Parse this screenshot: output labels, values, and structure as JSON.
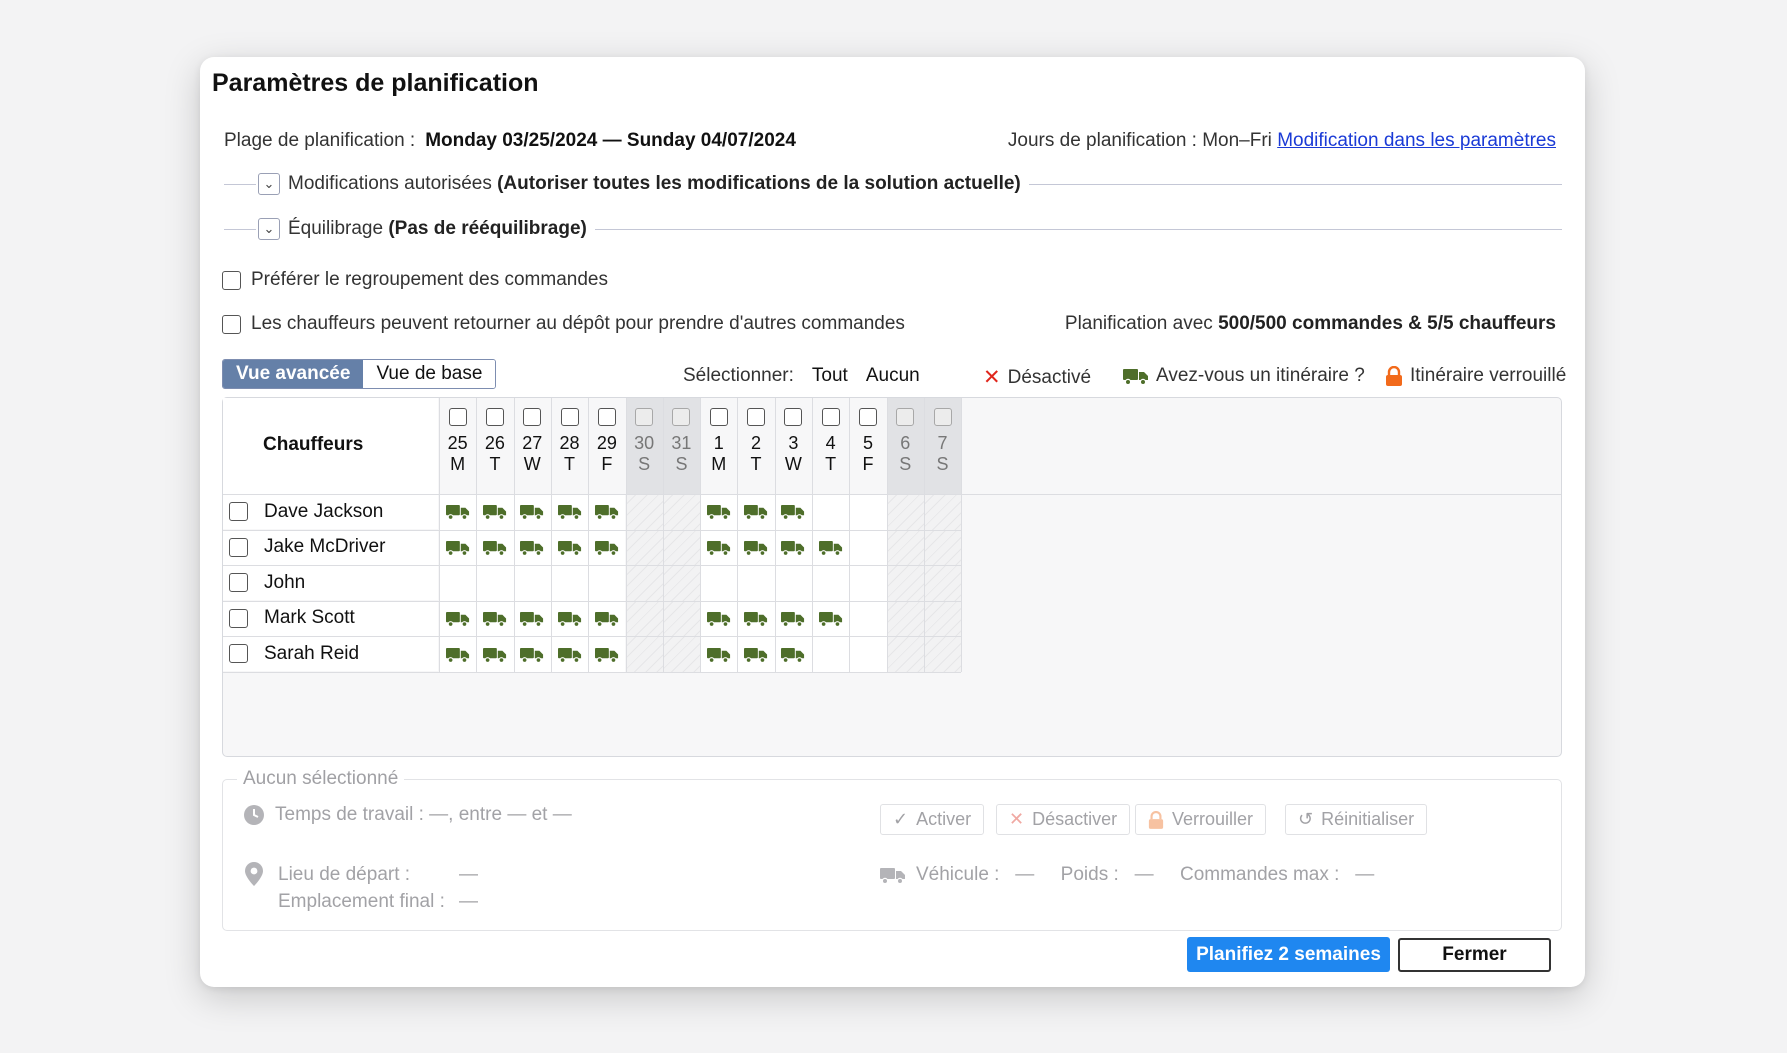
{
  "dialog": {
    "title": "Paramètres de planification",
    "range_label": "Plage de planification :",
    "range_value": "Monday 03/25/2024 — Sunday 04/07/2024",
    "jours_label": "Jours de planification : Mon–Fri",
    "jours_link": "Modification dans les paramètres"
  },
  "sections": {
    "modifs_label": "Modifications autorisées",
    "modifs_value": "(Autoriser toutes les modifications de la solution actuelle)",
    "equil_label": "Équilibrage",
    "equil_value": "(Pas de rééquilibrage)"
  },
  "options": {
    "regroup": "Préférer le regroupement des commandes",
    "retour": "Les chauffeurs peuvent retourner au dépôt pour prendre d'autres commandes"
  },
  "plan_count": {
    "prefix": "Planification avec",
    "value": "500/500 commandes & 5/5 chauffeurs"
  },
  "view_toggle": {
    "advanced": "Vue avancée",
    "basic": "Vue de base"
  },
  "select": {
    "label": "Sélectionner:",
    "all": "Tout",
    "none": "Aucun"
  },
  "legend": {
    "disabled": "Désactivé",
    "itinerary": "Avez-vous un itinéraire ?",
    "locked": "Itinéraire verrouillé"
  },
  "colors": {
    "truck": "#4e6e2a",
    "disabled_x": "#e0261c",
    "lock": "#f26a1b",
    "primary": "#1f87f0",
    "toggle_on": "#6580a8"
  },
  "grid": {
    "drivers_header": "Chauffeurs",
    "days": [
      {
        "num": "25",
        "letter": "M",
        "weekend": false
      },
      {
        "num": "26",
        "letter": "T",
        "weekend": false
      },
      {
        "num": "27",
        "letter": "W",
        "weekend": false
      },
      {
        "num": "28",
        "letter": "T",
        "weekend": false
      },
      {
        "num": "29",
        "letter": "F",
        "weekend": false
      },
      {
        "num": "30",
        "letter": "S",
        "weekend": true
      },
      {
        "num": "31",
        "letter": "S",
        "weekend": true
      },
      {
        "num": "1",
        "letter": "M",
        "weekend": false
      },
      {
        "num": "2",
        "letter": "T",
        "weekend": false
      },
      {
        "num": "3",
        "letter": "W",
        "weekend": false
      },
      {
        "num": "4",
        "letter": "T",
        "weekend": false
      },
      {
        "num": "5",
        "letter": "F",
        "weekend": false
      },
      {
        "num": "6",
        "letter": "S",
        "weekend": true
      },
      {
        "num": "7",
        "letter": "S",
        "weekend": true
      }
    ],
    "drivers": [
      {
        "name": "Dave Jackson",
        "trucks": [
          1,
          1,
          1,
          1,
          1,
          0,
          0,
          1,
          1,
          1,
          0,
          0,
          0,
          0
        ]
      },
      {
        "name": "Jake McDriver",
        "trucks": [
          1,
          1,
          1,
          1,
          1,
          0,
          0,
          1,
          1,
          1,
          1,
          0,
          0,
          0
        ]
      },
      {
        "name": "John",
        "trucks": [
          0,
          0,
          0,
          0,
          0,
          0,
          0,
          0,
          0,
          0,
          0,
          0,
          0,
          0
        ]
      },
      {
        "name": "Mark Scott",
        "trucks": [
          1,
          1,
          1,
          1,
          1,
          0,
          0,
          1,
          1,
          1,
          1,
          0,
          0,
          0
        ]
      },
      {
        "name": "Sarah Reid",
        "trucks": [
          1,
          1,
          1,
          1,
          1,
          0,
          0,
          1,
          1,
          1,
          0,
          0,
          0,
          0
        ]
      }
    ]
  },
  "details": {
    "title": "Aucun sélectionné",
    "work_time": "Temps de travail :  —, entre  —  et  —",
    "start_label": "Lieu de départ :",
    "start_value": "—",
    "end_label": "Emplacement final :",
    "end_value": "—",
    "vehicle": "Véhicule :   —     Poids :   —     Commandes max :   —",
    "btn_activate": "Activer",
    "btn_deactivate": "Désactiver",
    "btn_lock": "Verrouiller",
    "btn_reset": "Réinitialiser"
  },
  "footer": {
    "plan_button": "Planifiez 2 semaines",
    "close_button": "Fermer"
  }
}
